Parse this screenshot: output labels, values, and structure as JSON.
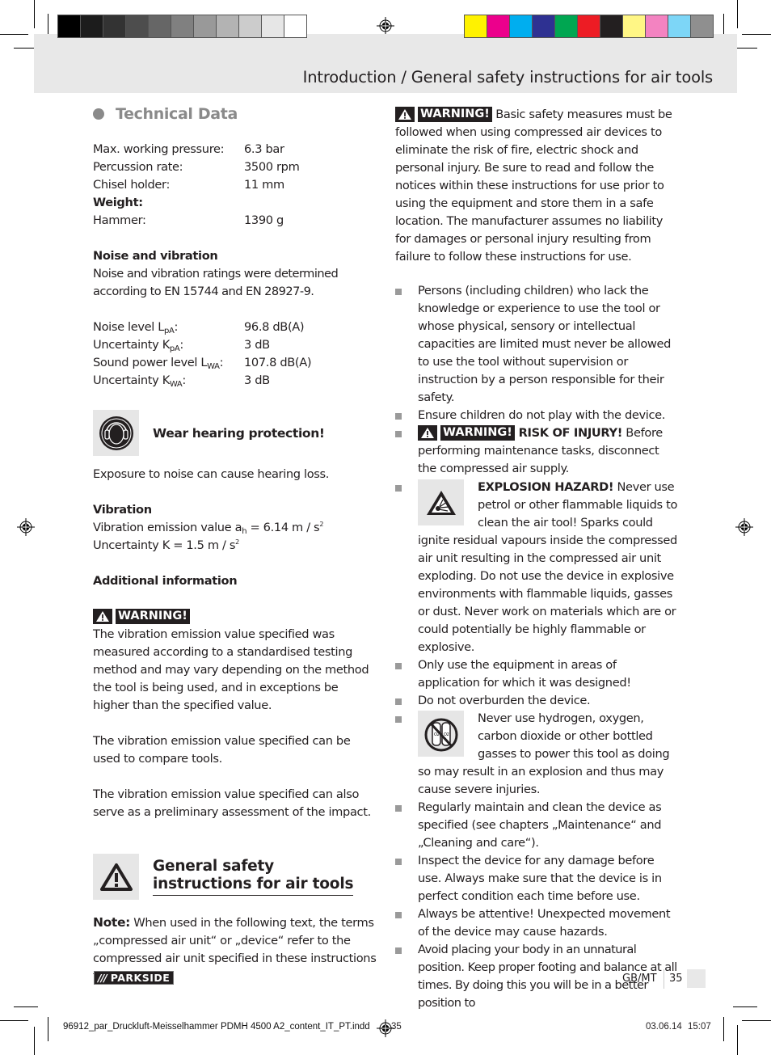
{
  "print_marks": {
    "gray_swatches": [
      "#000000",
      "#1c1c1c",
      "#333333",
      "#4d4d4d",
      "#666666",
      "#808080",
      "#999999",
      "#b3b3b3",
      "#cccccc",
      "#e6e6e6",
      "#ffffff"
    ],
    "color_swatches": [
      "#fff200",
      "#ec008c",
      "#00aeef",
      "#2e3192",
      "#00a651",
      "#ed1c24",
      "#231f20",
      "#fff685",
      "#f383c1",
      "#7dd6f7",
      "#8f8f8f"
    ]
  },
  "header": {
    "title": "Introduction / General safety instructions for air tools"
  },
  "technical_data": {
    "title": "Technical Data",
    "specs": [
      {
        "label": "Max. working pressure:",
        "value": "6.3 bar"
      },
      {
        "label": "Percussion rate:",
        "value": "3500 rpm"
      },
      {
        "label": "Chisel holder:",
        "value": "11 mm"
      }
    ],
    "weight_heading": "Weight:",
    "weight": {
      "label": "Hammer:",
      "value": "1390 g"
    },
    "noise_heading": "Noise and vibration",
    "noise_intro": "Noise and vibration ratings were determined according to EN 15744 and EN 28927-9.",
    "noise": [
      {
        "label": "Noise level L",
        "sub": "pA",
        "suffix": ":",
        "value": "96.8 dB(A)"
      },
      {
        "label": "Uncertainty K",
        "sub": "pA",
        "suffix": ":",
        "value": "3 dB"
      },
      {
        "label": "Sound power level L",
        "sub": "WA",
        "suffix": ":",
        "value": "107.8 dB(A)"
      },
      {
        "label": "Uncertainty K",
        "sub": "WA",
        "suffix": ":",
        "value": "3 dB"
      }
    ],
    "hearing_label": "Wear hearing protection!",
    "hearing_text": "Exposure to noise can cause hearing loss.",
    "vibration_heading": "Vibration",
    "vibration_line1_pre": "Vibration emission value a",
    "vibration_line1_sub": "h",
    "vibration_line1_post": " = 6.14 m / s",
    "vibration_line2_pre": "Uncertainty K = 1.5 m / s",
    "sq": "2",
    "additional_heading": "Additional information",
    "warning_label": "WARNING!",
    "additional_p1": "The vibration emission value specified was measured according to a standardised testing method and may vary depending on the method the tool is being used, and in exceptions be higher than the specified value.",
    "additional_p2": "The vibration emission value specified can be used to compare tools.",
    "additional_p3": "The vibration emission value specified can also serve as a preliminary assessment of the impact."
  },
  "general_safety": {
    "title_line1": "General safety",
    "title_line2": "instructions for air tools",
    "note_label": "Note:",
    "note_text": " When used in the following text, the terms „compressed air unit“ or „device“ refer to the compressed air unit specified in these instructions for use.",
    "warning_label": "WARNING!",
    "warning_text": " Basic safety measures must be followed when using compressed air devices to eliminate the risk of fire, electric shock and personal injury. Be sure to read and follow the notices within these instructions for use prior to using the equipment and store them in a safe location. The manufacturer assumes no liability for damages or personal injury resulting from failure to follow these instructions for use.",
    "bullets": {
      "b1": "Persons (including children) who lack the knowledge or experience to use the tool or whose physical, sensory or intellectual capacities are limited must never be allowed to use the tool without supervision or instruction by a person responsible for their safety.",
      "b2": "Ensure children do not play with the device.",
      "b3_warning": "WARNING!",
      "b3_bold": " RISK OF INJURY!",
      "b3_text": " Before performing maintenance tasks, disconnect the compressed air supply.",
      "b4_bold": "EXPLOSION HAZARD!",
      "b4_text": " Never use petrol or other flammable liquids to clean the air tool! Sparks could ignite residual vapours inside the compressed air unit resulting in the compressed air unit exploding. Do not use the device in explosive environments with flammable liquids, gasses or dust. Never work on materials which are or could potentially be highly flammable or explosive.",
      "b5": "Only use the equipment in areas of application for which it was designed!",
      "b6": "Do not overburden the device.",
      "b7": "Never use hydrogen, oxygen, carbon dioxide or other bottled gasses to power this tool as doing so may result in an explosion and thus may cause severe injuries.",
      "b8": "Regularly maintain and clean the device as specified (see chapters „Maintenance“ and „Cleaning and care“).",
      "b9": "Inspect the device for any damage before use. Always make sure that the device is in perfect condition each time before use.",
      "b10": "Always be attentive! Unexpected movement of the device may cause hazards.",
      "b11": "Avoid placing your body in an unnatural position. Keep proper footing and balance at all times. By doing this you will be in a better position to"
    }
  },
  "footer": {
    "brand": "PARKSIDE",
    "brand_slashes": "///",
    "lang": "GB/MT",
    "page": "35"
  },
  "slug": {
    "file": "96912_par_Druckluft-Meisselhammer PDMH 4500 A2_content_IT_PT.indd",
    "page": "35",
    "date": "03.06.14 15:07"
  }
}
